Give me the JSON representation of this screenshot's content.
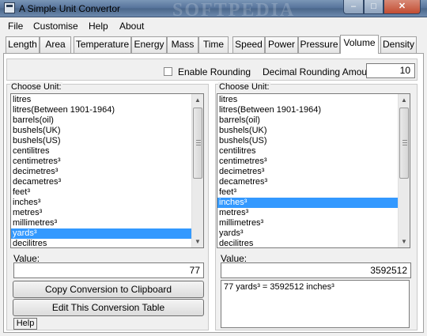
{
  "window": {
    "title": "A Simple Unit Convertor",
    "watermark": "SOFTPEDIA",
    "min_glyph": "–",
    "max_glyph": "□",
    "close_glyph": "✕"
  },
  "menu": [
    "File",
    "Customise",
    "Help",
    "About"
  ],
  "tabs": [
    "Length",
    "Area",
    "Temperature",
    "Energy",
    "Mass",
    "Time",
    "Speed",
    "Power",
    "Pressure",
    "Volume",
    "Density"
  ],
  "active_tab": "Volume",
  "rounding": {
    "checkbox_label": "Enable Rounding",
    "checked": false,
    "amount_label": "Decimal Rounding Amount:",
    "amount": "10"
  },
  "left": {
    "group_label": "Choose Unit:",
    "items": [
      "litres",
      "litres(Between 1901-1964)",
      "barrels(oil)",
      "bushels(UK)",
      "bushels(US)",
      "centilitres",
      "centimetres³",
      "decimetres³",
      "decametres³",
      "feet³",
      "inches³",
      "metres³",
      "millimetres³",
      "yards³",
      "decilitres"
    ],
    "selected": "yards³",
    "value_label": "Value:",
    "value": "77",
    "copy_button": "Copy Conversion to Clipboard",
    "edit_button": "Edit This Conversion Table",
    "help_button": "Help"
  },
  "right": {
    "group_label": "Choose Unit:",
    "items": [
      "litres",
      "litres(Between 1901-1964)",
      "barrels(oil)",
      "bushels(UK)",
      "bushels(US)",
      "centilitres",
      "centimetres³",
      "decimetres³",
      "decametres³",
      "feet³",
      "inches³",
      "metres³",
      "millimetres³",
      "yards³",
      "decilitres"
    ],
    "selected": "inches³",
    "value_label": "Value:",
    "value": "3592512",
    "result_text": "77 yards³ = 3592512 inches³"
  },
  "colors": {
    "selection": "#3399ff",
    "titlebar": "#55729a"
  },
  "icons": {
    "up_arrow": "▲",
    "down_arrow": "▼"
  }
}
